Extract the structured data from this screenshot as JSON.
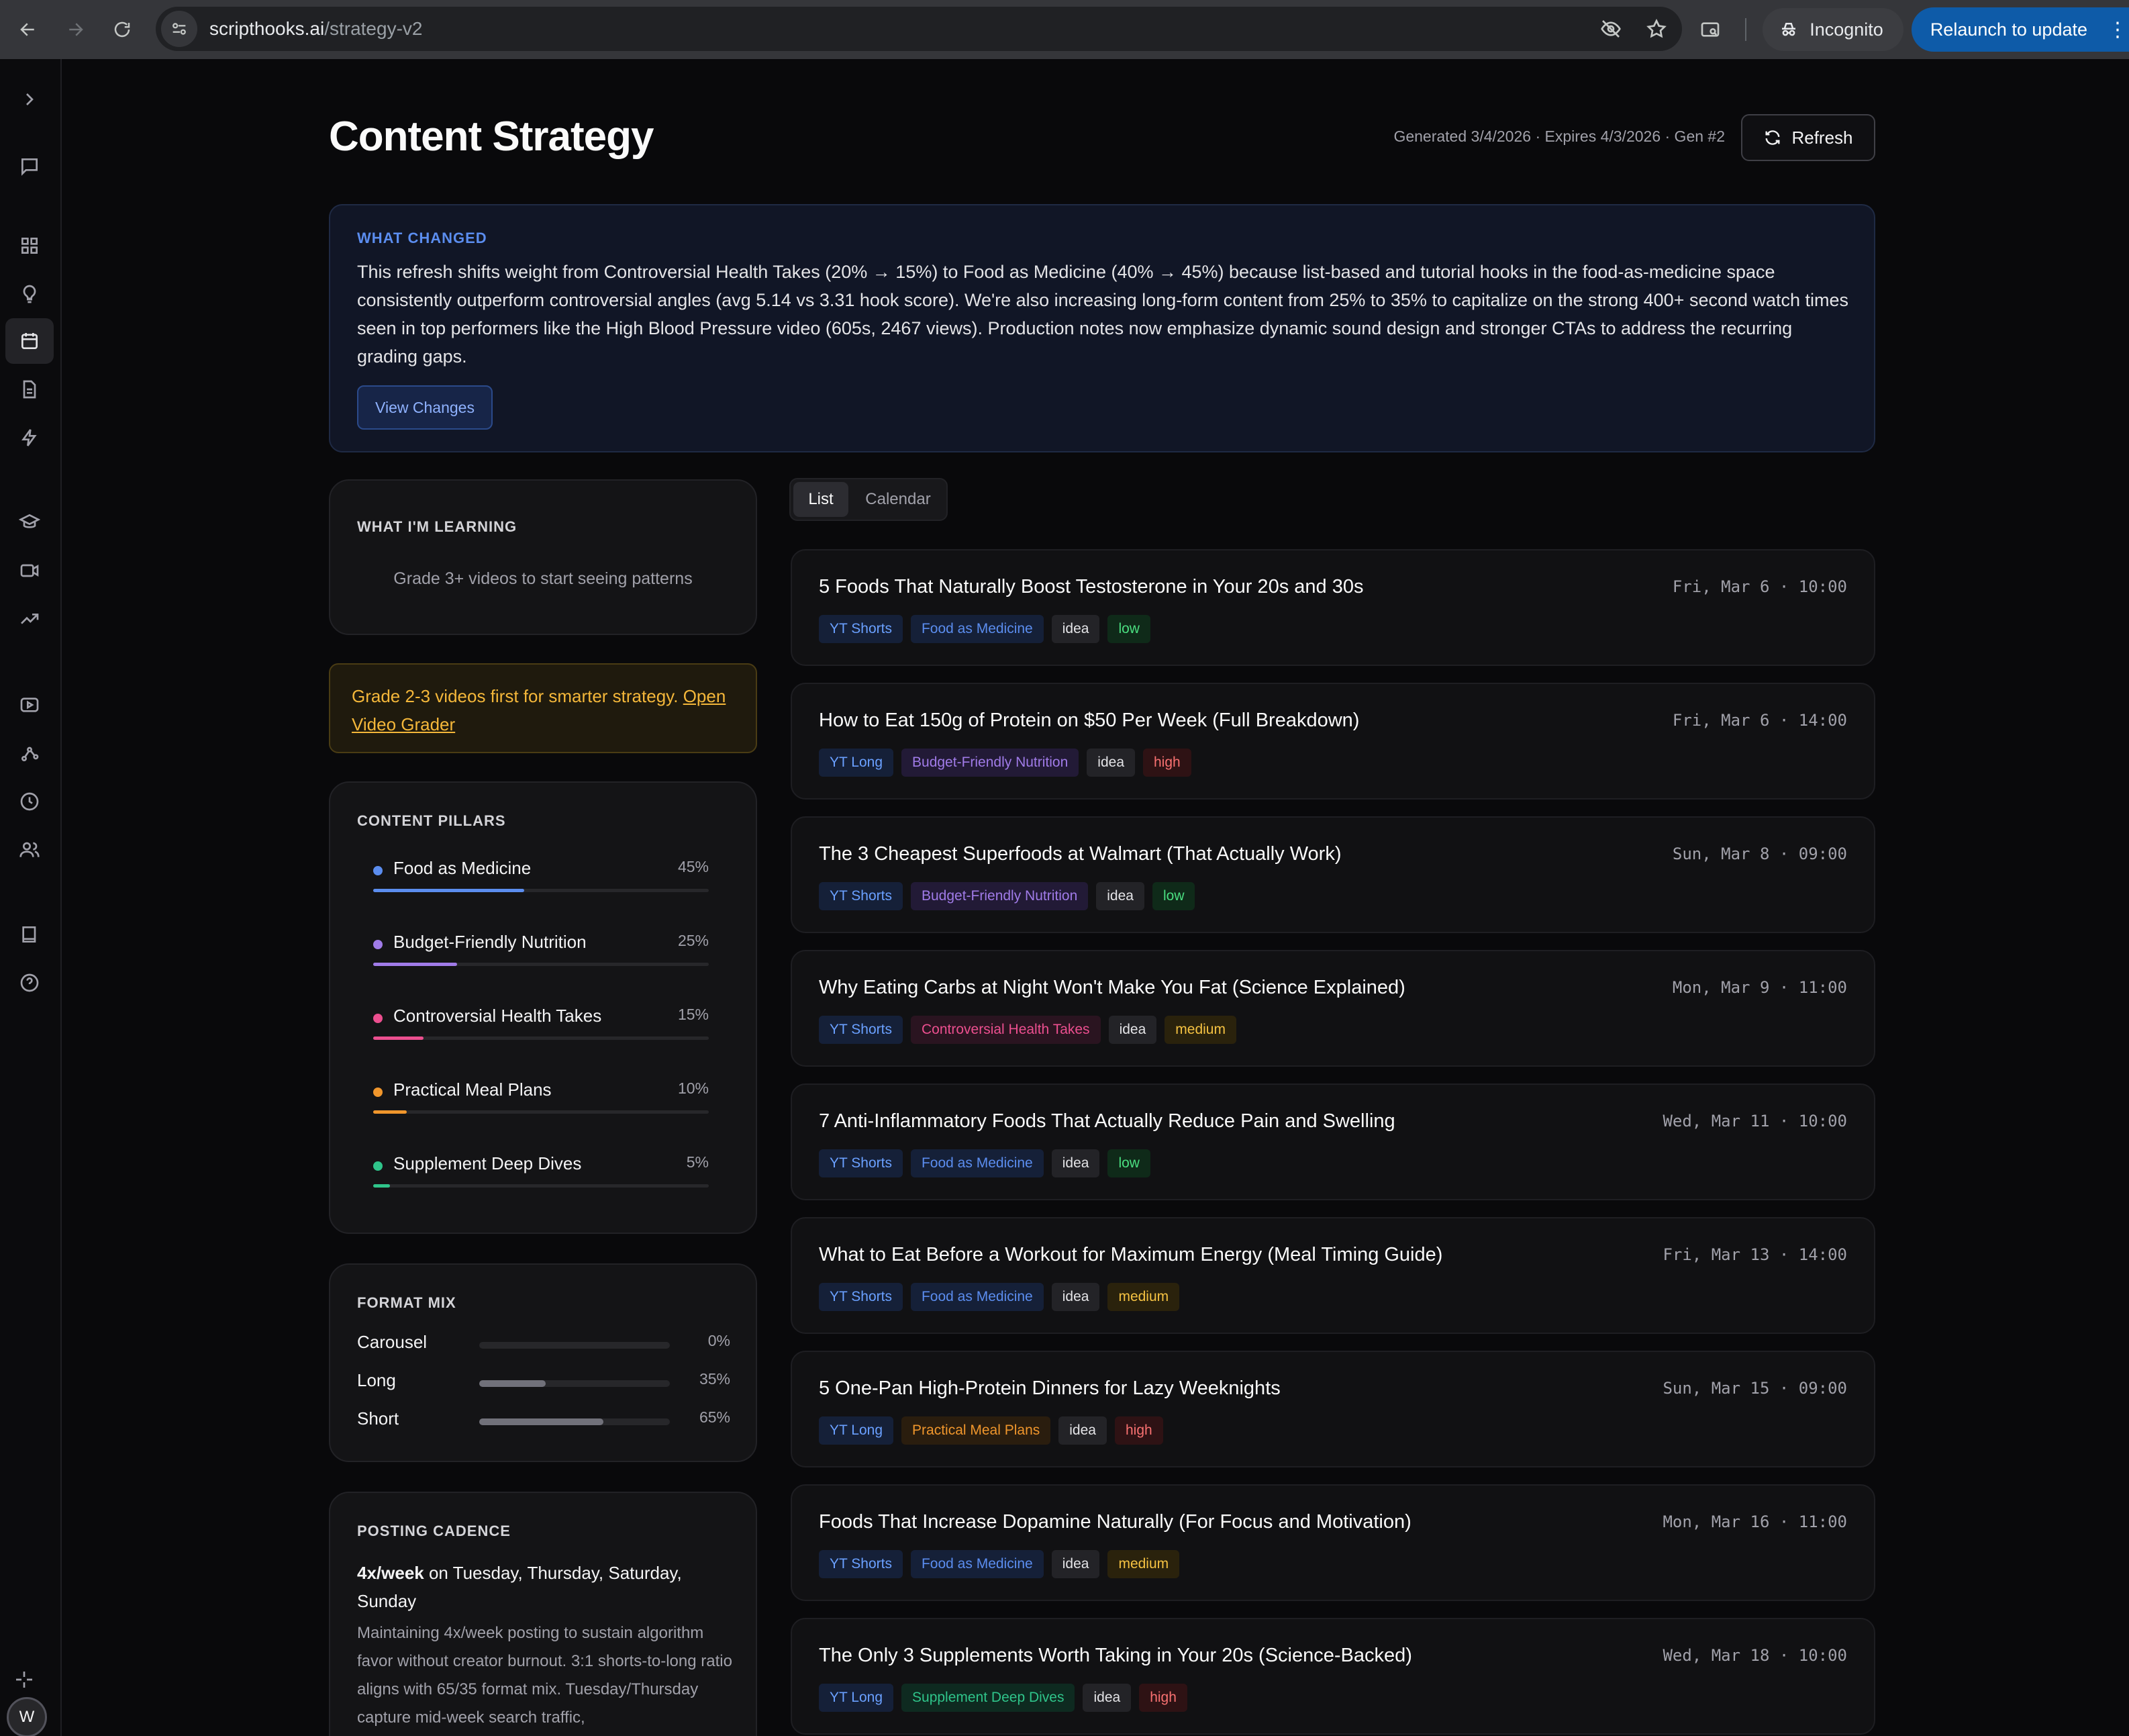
{
  "browser": {
    "url_host": "scripthooks.ai",
    "url_path": "/strategy-v2",
    "incognito_label": "Incognito",
    "relaunch_label": "Relaunch to update"
  },
  "page": {
    "title": "Content Strategy",
    "meta": "Generated 3/4/2026 · Expires 4/3/2026 · Gen #2",
    "refresh_label": "Refresh"
  },
  "what_changed": {
    "label": "WHAT CHANGED",
    "text": "This refresh shifts weight from Controversial Health Takes (20% → 15%) to Food as Medicine (40% → 45%) because list-based and tutorial hooks in the food-as-medicine space consistently outperform controversial angles (avg 5.14 vs 3.31 hook score). We're also increasing long-form content from 25% to 35% to capitalize on the strong 400+ second watch times seen in top performers like the High Blood Pressure video (605s, 2467 views). Production notes now emphasize dynamic sound design and stronger CTAs to address the recurring grading gaps.",
    "button": "View Changes"
  },
  "learning": {
    "label": "WHAT I'M LEARNING",
    "hint": "Grade 3+ videos to start seeing patterns"
  },
  "warning": {
    "text": "Grade 2-3 videos first for smarter strategy.",
    "link": "Open Video Grader"
  },
  "pillars": {
    "label": "CONTENT PILLARS",
    "items": [
      {
        "name": "Food as Medicine",
        "pct": "45%",
        "value": 0.45,
        "color": "#5b8def"
      },
      {
        "name": "Budget-Friendly Nutrition",
        "pct": "25%",
        "value": 0.25,
        "color": "#a07be8"
      },
      {
        "name": "Controversial Health Takes",
        "pct": "15%",
        "value": 0.15,
        "color": "#ec4f8f"
      },
      {
        "name": "Practical Meal Plans",
        "pct": "10%",
        "value": 0.1,
        "color": "#f0962c"
      },
      {
        "name": "Supplement Deep Dives",
        "pct": "5%",
        "value": 0.05,
        "color": "#2fc48a"
      }
    ]
  },
  "format_mix": {
    "label": "FORMAT MIX",
    "items": [
      {
        "name": "Carousel",
        "pct": "0%",
        "value": 0.0
      },
      {
        "name": "Long",
        "pct": "35%",
        "value": 0.35
      },
      {
        "name": "Short",
        "pct": "65%",
        "value": 0.65
      }
    ]
  },
  "cadence": {
    "label": "POSTING CADENCE",
    "freq": "4x/week",
    "days": " on Tuesday, Thursday, Saturday, Sunday",
    "desc": "Maintaining 4x/week posting to sustain algorithm favor without creator burnout. 3:1 shorts-to-long ratio aligns with 65/35 format mix. Tuesday/Thursday capture mid-week search traffic,"
  },
  "view_toggle": {
    "list": "List",
    "calendar": "Calendar"
  },
  "ideas": [
    {
      "title": "5 Foods That Naturally Boost Testosterone in Your 20s and 30s",
      "date": "Fri, Mar 6 · 10:00",
      "format": "YT Shorts",
      "pillar": "Food as Medicine",
      "pillar_class": "t-food",
      "status": "idea",
      "priority": "low"
    },
    {
      "title": "How to Eat 150g of Protein on $50 Per Week (Full Breakdown)",
      "date": "Fri, Mar 6 · 14:00",
      "format": "YT Long",
      "pillar": "Budget-Friendly Nutrition",
      "pillar_class": "t-budget",
      "status": "idea",
      "priority": "high"
    },
    {
      "title": "The 3 Cheapest Superfoods at Walmart (That Actually Work)",
      "date": "Sun, Mar 8 · 09:00",
      "format": "YT Shorts",
      "pillar": "Budget-Friendly Nutrition",
      "pillar_class": "t-budget",
      "status": "idea",
      "priority": "low"
    },
    {
      "title": "Why Eating Carbs at Night Won't Make You Fat (Science Explained)",
      "date": "Mon, Mar 9 · 11:00",
      "format": "YT Shorts",
      "pillar": "Controversial Health Takes",
      "pillar_class": "t-contro",
      "status": "idea",
      "priority": "medium"
    },
    {
      "title": "7 Anti-Inflammatory Foods That Actually Reduce Pain and Swelling",
      "date": "Wed, Mar 11 · 10:00",
      "format": "YT Shorts",
      "pillar": "Food as Medicine",
      "pillar_class": "t-food",
      "status": "idea",
      "priority": "low"
    },
    {
      "title": "What to Eat Before a Workout for Maximum Energy (Meal Timing Guide)",
      "date": "Fri, Mar 13 · 14:00",
      "format": "YT Shorts",
      "pillar": "Food as Medicine",
      "pillar_class": "t-food",
      "status": "idea",
      "priority": "medium"
    },
    {
      "title": "5 One-Pan High-Protein Dinners for Lazy Weeknights",
      "date": "Sun, Mar 15 · 09:00",
      "format": "YT Long",
      "pillar": "Practical Meal Plans",
      "pillar_class": "t-meal",
      "status": "idea",
      "priority": "high"
    },
    {
      "title": "Foods That Increase Dopamine Naturally (For Focus and Motivation)",
      "date": "Mon, Mar 16 · 11:00",
      "format": "YT Shorts",
      "pillar": "Food as Medicine",
      "pillar_class": "t-food",
      "status": "idea",
      "priority": "medium"
    },
    {
      "title": "The Only 3 Supplements Worth Taking in Your 20s (Science-Backed)",
      "date": "Wed, Mar 18 · 10:00",
      "format": "YT Long",
      "pillar": "Supplement Deep Dives",
      "pillar_class": "t-supp",
      "status": "idea",
      "priority": "high"
    }
  ],
  "sidebar": {
    "icons": [
      "chevron-right-icon",
      "chat-icon",
      "grid-icon",
      "lightbulb-icon",
      "calendar-icon",
      "document-icon",
      "lightning-icon",
      "graduation-cap-icon",
      "video-icon",
      "trending-icon",
      "play-icon",
      "nodes-icon",
      "clock-icon",
      "users-icon",
      "book-icon",
      "help-icon",
      "sparkle-icon"
    ],
    "avatar_initial": "W"
  }
}
